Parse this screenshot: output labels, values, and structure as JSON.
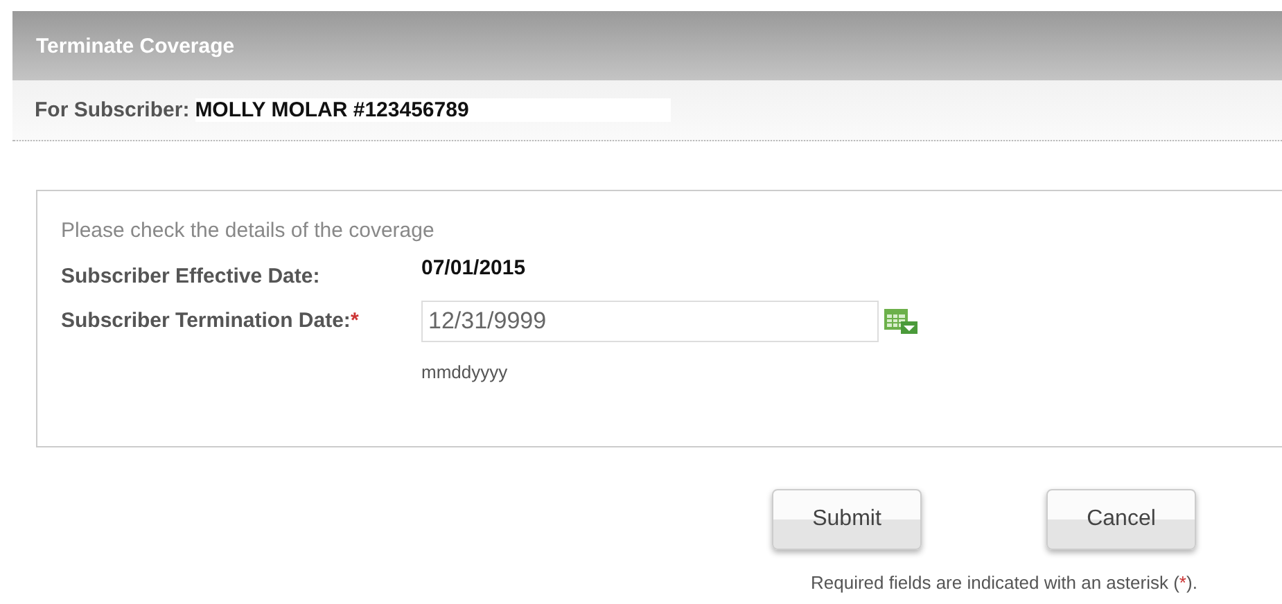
{
  "window": {
    "title": "Terminate Coverage"
  },
  "subscriber": {
    "label": "For Subscriber:",
    "value": "MOLLY MOLAR #123456789"
  },
  "panel": {
    "intro": "Please check the details of the coverage",
    "fields": [
      {
        "kind": "text",
        "label": "Subscriber Effective Date:",
        "value": "07/01/2015"
      },
      {
        "kind": "date",
        "label": "Subscriber Termination Date:",
        "required_mark": "*",
        "value": "12/31/9999",
        "hint": "mmddyyyy"
      }
    ]
  },
  "buttons": [
    "Submit",
    "Cancel"
  ],
  "footnote": {
    "before": "Required fields are indicated with an asterisk (",
    "mark": "*",
    "after": ")."
  }
}
